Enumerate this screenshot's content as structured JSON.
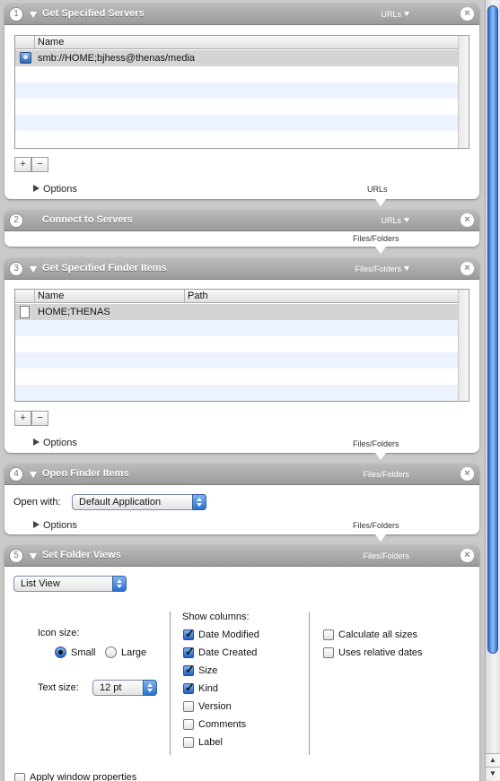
{
  "actions": [
    {
      "number": "1",
      "title": "Get Specified Servers",
      "io_type": "URLs",
      "options_label": "Options",
      "footer_type": "URLs",
      "table": {
        "columns": [
          "Name"
        ],
        "rows": [
          [
            "smb://HOME;bjhess@thenas/media"
          ]
        ]
      }
    },
    {
      "number": "2",
      "title": "Connect to Servers",
      "io_type": "URLs",
      "footer_type": "Files/Folders"
    },
    {
      "number": "3",
      "title": "Get Specified Finder Items",
      "io_type": "Files/Folders",
      "options_label": "Options",
      "footer_type": "Files/Folders",
      "table": {
        "columns": [
          "Name",
          "Path"
        ],
        "rows": [
          [
            "HOME;THENAS",
            ""
          ]
        ]
      }
    },
    {
      "number": "4",
      "title": "Open Finder Items",
      "io_type": "Files/Folders",
      "open_with_label": "Open with:",
      "open_with_value": "Default Application",
      "options_label": "Options",
      "footer_type": "Files/Folders"
    },
    {
      "number": "5",
      "title": "Set Folder Views",
      "io_type": "Files/Folders",
      "view_value": "List View",
      "icon_size_label": "Icon size:",
      "icon_size_options": [
        "Small",
        "Large"
      ],
      "icon_size_selected": "Small",
      "text_size_label": "Text size:",
      "text_size_value": "12 pt",
      "show_columns_label": "Show columns:",
      "columns": [
        {
          "label": "Date Modified",
          "checked": true
        },
        {
          "label": "Date Created",
          "checked": true
        },
        {
          "label": "Size",
          "checked": true
        },
        {
          "label": "Kind",
          "checked": true
        },
        {
          "label": "Version",
          "checked": false
        },
        {
          "label": "Comments",
          "checked": false
        },
        {
          "label": "Label",
          "checked": false
        }
      ],
      "extra_options": [
        {
          "label": "Calculate all sizes",
          "checked": false
        },
        {
          "label": "Uses relative dates",
          "checked": false
        }
      ],
      "apply_window_label": "Apply window properties"
    }
  ],
  "buttons": {
    "add": "+",
    "remove": "−",
    "close": "×"
  },
  "scroll_arrows": {
    "up": "▲",
    "down": "▼"
  }
}
